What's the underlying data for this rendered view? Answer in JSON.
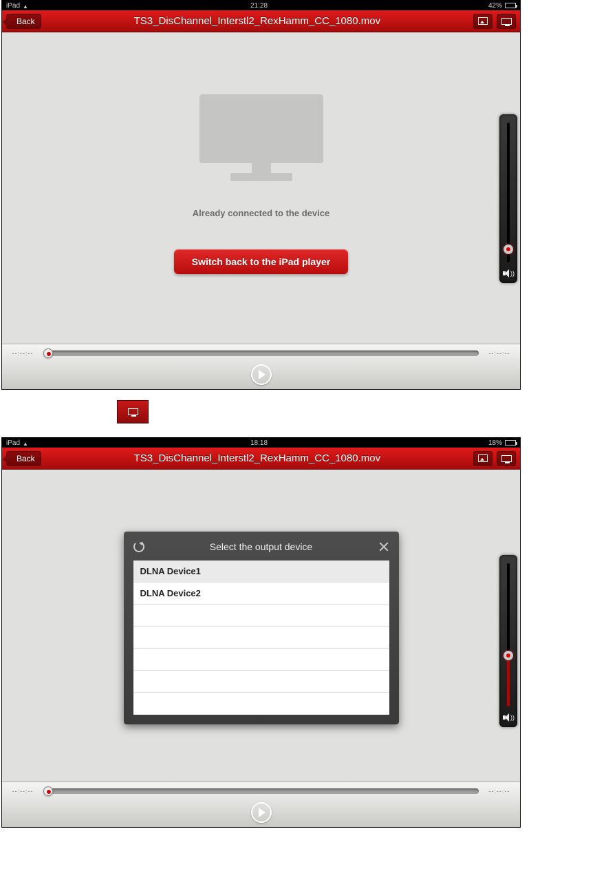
{
  "screenshot1": {
    "status": {
      "carrier": "iPad",
      "time": "21:28",
      "battery_pct": "42%"
    },
    "nav": {
      "back": "Back",
      "title": "TS3_DisChannel_Interstl2_RexHamm_CC_1080.mov"
    },
    "body": {
      "connected_text": "Already connected to the device",
      "switch_button": "Switch back to the iPad player"
    },
    "playbar": {
      "t_left": "--:--:--",
      "t_right": "--:--:--"
    },
    "volume": {
      "thumb_bottom_pct": 6
    }
  },
  "screenshot2": {
    "status": {
      "carrier": "iPad",
      "time": "18:18",
      "battery_pct": "18%"
    },
    "nav": {
      "back": "Back",
      "title": "TS3_DisChannel_Interstl2_RexHamm_CC_1080.mov"
    },
    "modal": {
      "title": "Select the output device",
      "devices": [
        "DLNA Device1",
        "DLNA Device2"
      ]
    },
    "playbar": {
      "t_left": "--:--:--",
      "t_right": "--:--:--"
    },
    "volume": {
      "thumb_bottom_pct": 32,
      "fill_pct": 32
    }
  }
}
